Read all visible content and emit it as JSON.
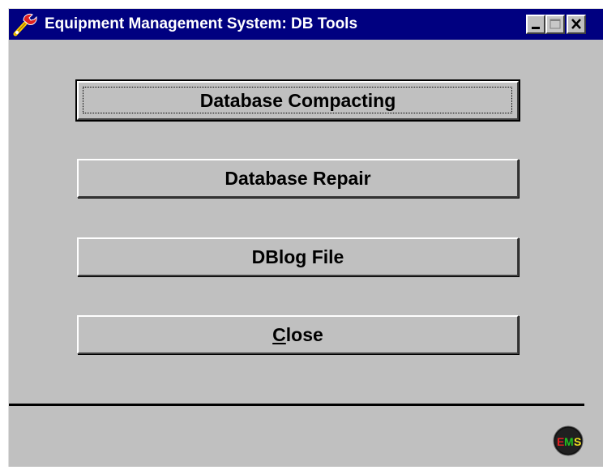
{
  "window": {
    "title": "Equipment Management System: DB Tools"
  },
  "title_controls": {
    "minimize": "minimize-icon",
    "maximize": "maximize-icon",
    "close": "close-icon"
  },
  "buttons": {
    "compacting": "Database Compacting",
    "repair": "Database Repair",
    "dblog": "DBlog File",
    "close_mnemonic": "C",
    "close_rest": "lose"
  },
  "logo": {
    "text_e": "E",
    "text_m": "M",
    "text_s": "S"
  },
  "colors": {
    "titlebar": "#000080",
    "face": "#c0c0c0",
    "logo_e": "#e02020",
    "logo_m": "#20c020",
    "logo_s": "#f0e020"
  }
}
